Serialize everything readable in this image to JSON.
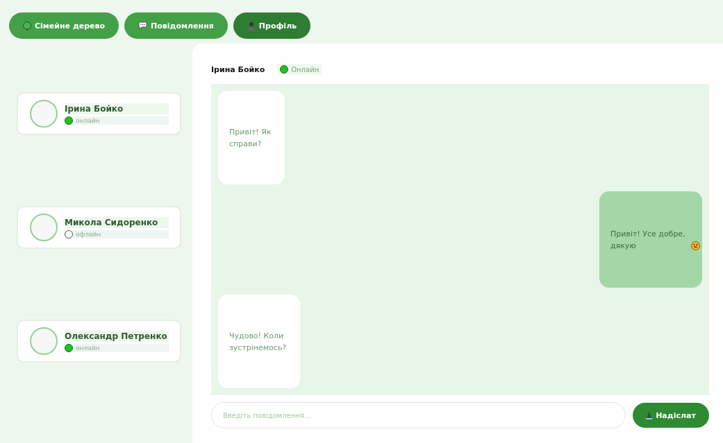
{
  "nav": [
    {
      "label": "Сімейне дерево",
      "kind": "tree",
      "selected": false
    },
    {
      "label": "Повідомлення",
      "kind": "chat",
      "selected": false
    },
    {
      "label": "Профіль",
      "kind": "person",
      "selected": true
    }
  ],
  "contacts": [
    {
      "name": "Ірина Бойко",
      "online": true,
      "status": "онлайн"
    },
    {
      "name": "Микола Сидоренко",
      "online": false,
      "status": "офлайн"
    },
    {
      "name": "Олександр Петренко",
      "online": true,
      "status": "онлайн"
    }
  ],
  "chat": {
    "name": "Ірина Бойко",
    "online": true,
    "status": "Онлайн",
    "messages": [
      {
        "kind": "incoming",
        "text": "Привіт! Як справи?",
        "emoji": false
      },
      {
        "kind": "outgoing",
        "text": "Привіт! Усе добре, дякую",
        "emoji": true
      },
      {
        "kind": "incoming",
        "text": "Чудово! Коли зустрінемось?",
        "emoji": false
      }
    ],
    "input": {
      "placeholder": "Введіть повідомлення..."
    },
    "send": "Надіслат"
  }
}
